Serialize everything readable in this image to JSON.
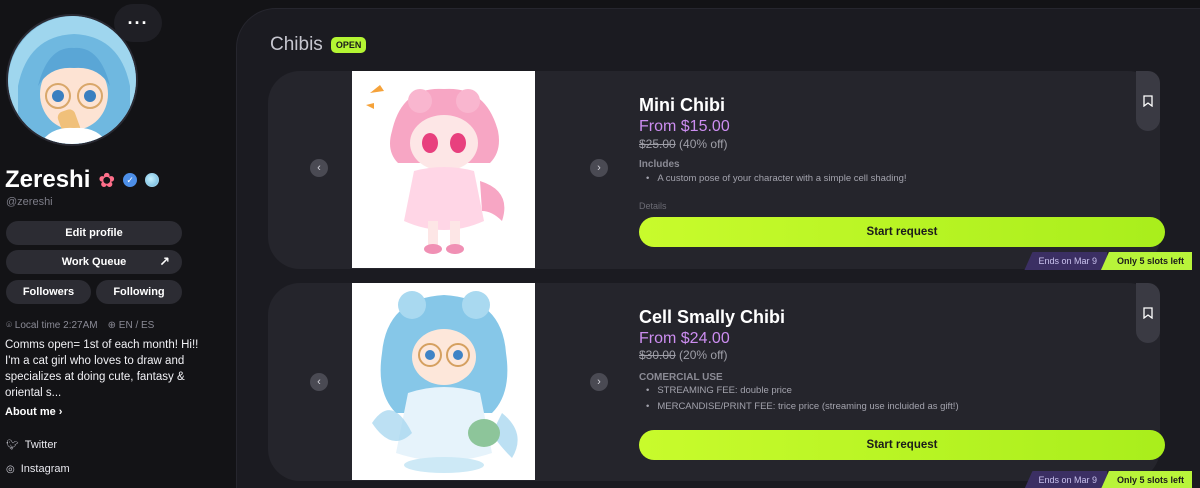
{
  "profile": {
    "more_label": "···",
    "name": "Zereshi",
    "handle": "@zereshi",
    "name_emoji": "✿",
    "edit_profile": "Edit profile",
    "work_queue": "Work Queue",
    "followers": "Followers",
    "following": "Following",
    "local_time": "Local time 2:27AM",
    "languages": "EN / ES",
    "bio": "Comms open= 1st of each month! Hi!! I'm a cat girl who loves to draw and specializes at doing cute, fantasy & oriental s...",
    "about_me": "About me",
    "twitter": "Twitter",
    "instagram": "Instagram"
  },
  "section": {
    "title": "Chibis",
    "badge": "OPEN"
  },
  "cards": [
    {
      "title": "Mini Chibi",
      "price": "From $15.00",
      "old_price": "$25.00",
      "discount": "(40% off)",
      "label1": "Includes",
      "bullets": [
        "A custom pose of your character with a simple cell shading!"
      ],
      "label2": "Details",
      "button": "Start request",
      "ends": "Ends on Mar 9",
      "slots": "Only 5 slots left"
    },
    {
      "title": "Cell Smally Chibi",
      "price": "From $24.00",
      "old_price": "$30.00",
      "discount": "(20% off)",
      "label1": "COMERCIAL USE",
      "bullets": [
        "STREAMING FEE: double price",
        "MERCANDISE/PRINT FEE: trice price (streaming use incluided as gift!)"
      ],
      "button": "Start request",
      "ends": "Ends on Mar 9",
      "slots": "Only 5 slots left"
    }
  ],
  "colors": {
    "accent_green": "#b4f533",
    "price_purple": "#cc8df0",
    "background": "#131316",
    "panel": "#1b1b21",
    "card": "#25252c"
  }
}
